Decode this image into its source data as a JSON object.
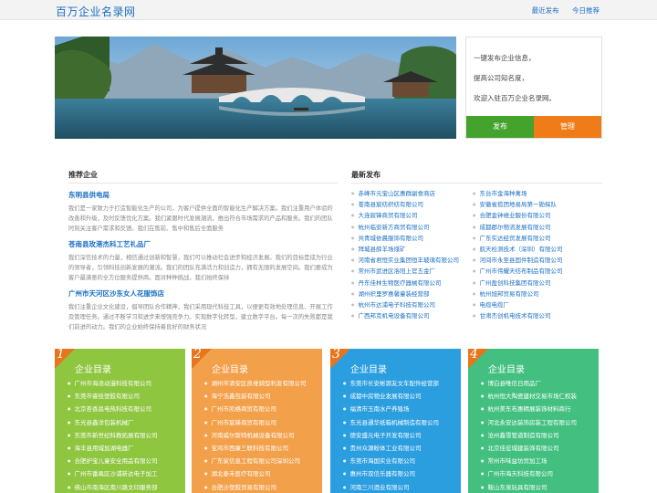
{
  "site": {
    "logo": "百万企业名录网"
  },
  "toplinks": [
    "最近发布",
    "今日推荐"
  ],
  "panel": {
    "lines": [
      "一键发布企业信息，",
      "提高公司知名度，",
      "欢迎入驻百万企业名录网。"
    ],
    "publish": "发布",
    "manage": "管理"
  },
  "sections": {
    "recommend": "推荐企业",
    "latest": "最新发布"
  },
  "recommend": [
    {
      "name": "东明县供电局",
      "desc": "我们是一家致力于打造智能化生产的公司，为客户提供全面的智能化生产解决方案。我们注重用户体验的改善和升级，及时反馈优化方案。我们紧跟时代发展潮流，推出符合市场需求的产品和服务。我们的团队时刻关注客户需求和反馈。我们在售前、售中和售后全面服务"
    },
    {
      "name": "苍南县玫港杰科工艺礼品厂",
      "desc": "我们深信技术的力量，相信通过创新和智慧，我们可以推动社会进步和经济发展。我们的目标是成为行业的领导者，引领科技创新发展的潮流。我们的团队充满活力和创造力，拥有无限的发展空间。我们要成为客户最满意的全方位服务提供商。面对种种挑战，我们始终保持"
    },
    {
      "name": "广州市天河区沙东女人花服饰店",
      "desc": "我们注重企业文化建设，倡导团队合作精神，我们采用现代科技工具，以便更有效地处理信息、开展工作及管理任务。通过不断学习和进步来增强竞争力。实现数字化转型，建立数字平台。每一次的失败都是我们前进的动力。我们的企业始终保持着良好的财务状况"
    }
  ],
  "latest_col1": [
    "赤峰市元宝山区惠群副食商店",
    "苍南县宸纺织纺有限公司",
    "大连宸锋商贸有限公司",
    "杭州临安新方商贸有限公司",
    "共青城依晨服饰有限公司",
    "拜城县薛羊场煤矿",
    "河南省君恒实业集团恒丰玻璃有限公司",
    "常州市武进区洛阳上官五金厂",
    "丹东佳林生物医疗器械有限公司",
    "湖州织里罗惠馨童装经营部",
    "杭州市达浦电子科技有限公司",
    "广西邦克机电设备有限公司"
  ],
  "latest_col2": [
    "东台市金海种禽场",
    "安徽省揽团地易局第一勘探队",
    "合肥金钟维业服份有限公司",
    "成都郡尔物流发展有限公司",
    "广东实达经贸发展有限公司",
    "航天检测技术（深圳）有限公司",
    "河间市永至县固件制造有限公司",
    "广州市伟耀天纺布制品有限公司",
    "广州盈创科技集团有限公司",
    "杭州旭邦贸易有限公司",
    "电缆电缆厂",
    "甘肃杰创机电技术有限公司"
  ],
  "cards": [
    {
      "num": "1",
      "title": "企业目录",
      "items": [
        "广州市海浪动漫科技有限公司",
        "东莞市睿技塑胶有限公司",
        "北京杏香昌电热科技有限公司",
        "东光县鑫洋包装机械厂",
        "东莞市新世纪科教拓展有限公司",
        "海丰县用城加湖电器厂",
        "合肥护宝儿童安全用品有限公司",
        "广州市番禺区沙浦新达电子加工",
        "佛山市南海区南川路文印服务部"
      ]
    },
    {
      "num": "2",
      "title": "企业目录",
      "items": [
        "湖州市清安区凯维骑型利发有限公司",
        "海宁浩鑫包装有限公司",
        "广州市凯格商贸有限公司",
        "广州市宸锋商贸有限公司",
        "河南威尔斯特机械设备有限公司",
        "宝鸡市西康三联科技有限公司",
        "广东家信息工程有限公司深圳公司",
        "湖北泰禾医疗有限公司",
        "合肥沙塑胶贸易有限公司"
      ]
    },
    {
      "num": "3",
      "title": "企业目录",
      "items": [
        "东莞市长安彬源友文车配件经营部",
        "成都中房物业发展有限公司",
        "福清市玉南水产养殖场",
        "东光县通华纸箱机械制造有限公司",
        "德安盛元电子开发有限公司",
        "贵州众源粉体工业有限公司",
        "东莞市海国实业有限公司",
        "惠州市双信乐器有限公司",
        "河南三川酒业有限公司"
      ]
    },
    {
      "num": "4",
      "title": "企业目录",
      "items": [
        "博白县唯信日用品厂",
        "杭州恒大陶瓷建材交易市场仁权装",
        "杭州美东布惠精展装饰材料商行",
        "河北永安达装饰房装工程有限公司",
        "沧州鑫雪管道制造有限公司",
        "北京佳宏城建装饰有限公司",
        "常州市味益坊贸加工场",
        "广州市海天科技有限公司",
        "鞍山东泉玩具有限公司"
      ]
    }
  ]
}
